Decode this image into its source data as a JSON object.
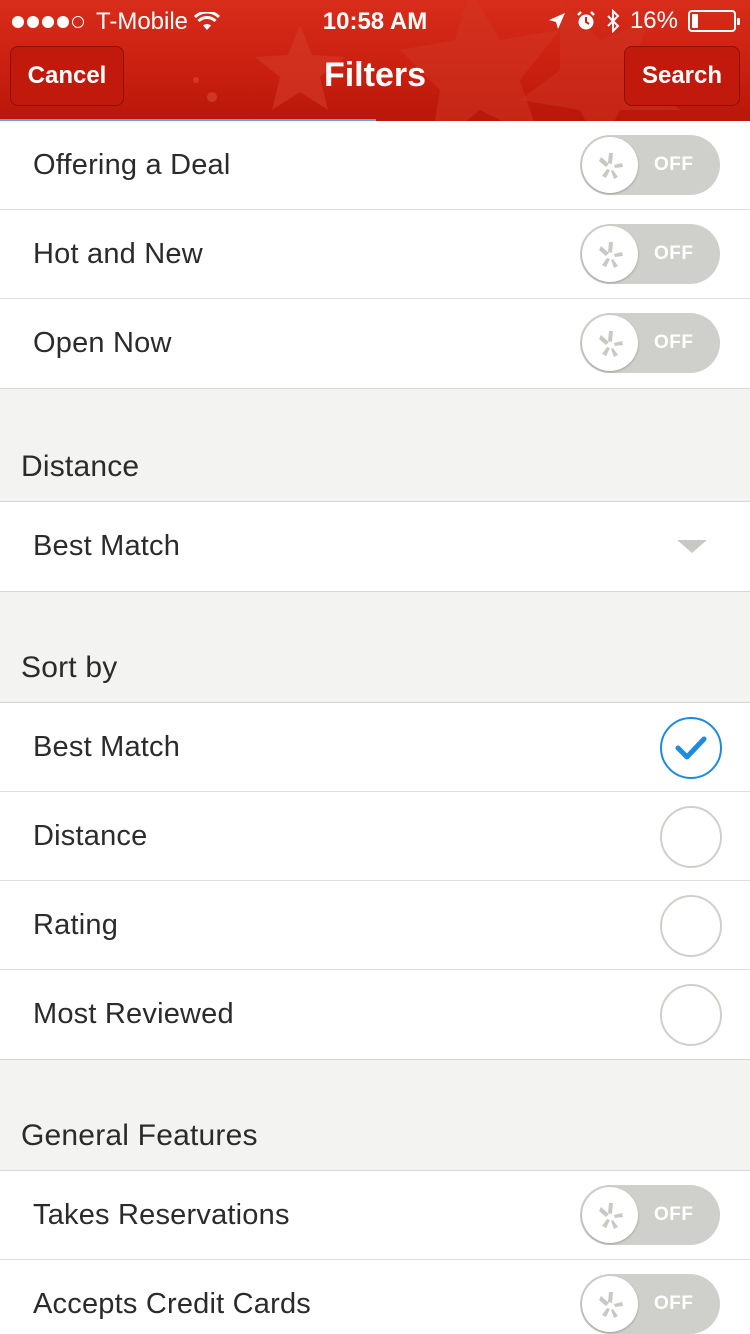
{
  "status_bar": {
    "carrier": "T-Mobile",
    "signal_dots_filled": 4,
    "signal_dots_total": 5,
    "time": "10:58 AM",
    "battery_percent_label": "16%",
    "battery_level": 0.16,
    "icons": [
      "wifi-icon",
      "location-arrow-icon",
      "alarm-icon",
      "bluetooth-icon",
      "battery-icon"
    ]
  },
  "header": {
    "title": "Filters",
    "cancel_label": "Cancel",
    "search_label": "Search"
  },
  "quick_toggles": [
    {
      "label": "Offering a Deal",
      "state": "OFF"
    },
    {
      "label": "Hot and New",
      "state": "OFF"
    },
    {
      "label": "Open Now",
      "state": "OFF"
    }
  ],
  "distance": {
    "heading": "Distance",
    "selected": "Best Match"
  },
  "sort_by": {
    "heading": "Sort by",
    "options": [
      {
        "label": "Best Match",
        "checked": true
      },
      {
        "label": "Distance",
        "checked": false
      },
      {
        "label": "Rating",
        "checked": false
      },
      {
        "label": "Most Reviewed",
        "checked": false
      }
    ]
  },
  "general_features": {
    "heading": "General Features",
    "toggles": [
      {
        "label": "Takes Reservations",
        "state": "OFF"
      },
      {
        "label": "Accepts Credit Cards",
        "state": "OFF"
      }
    ]
  },
  "colors": {
    "header_red": "#c91f10",
    "check_blue": "#1e8ae0",
    "toggle_off": "#cfcfcb",
    "background": "#f3f3f1"
  }
}
